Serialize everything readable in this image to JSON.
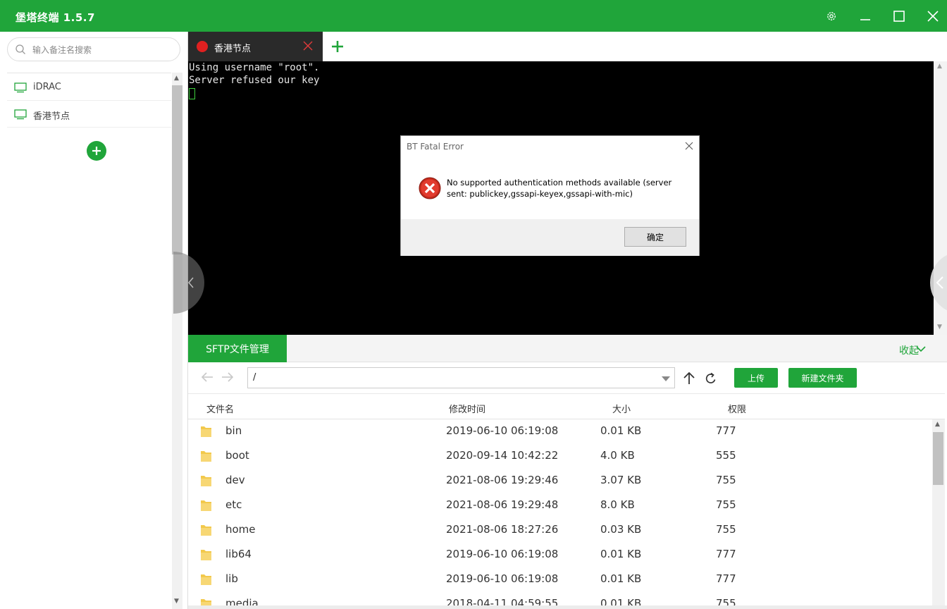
{
  "app": {
    "title": "堡塔终端 1.5.7"
  },
  "colors": {
    "brand": "#20a53a",
    "terminal_bg": "#000000",
    "tab_active_bg": "#2a2a2a",
    "status_dot": "#e02020"
  },
  "window_controls": [
    "gear-icon",
    "minimize-icon",
    "maximize-icon",
    "close-icon"
  ],
  "sidebar": {
    "search_placeholder": "输入备注名搜索",
    "servers": [
      {
        "label": "iDRAC",
        "icon": "monitor-icon"
      },
      {
        "label": "香港节点",
        "icon": "monitor-icon"
      }
    ]
  },
  "tabs": [
    {
      "label": "香港节点",
      "status": "disconnected"
    }
  ],
  "terminal": {
    "lines": [
      "Using username \"root\".",
      "Server refused our key"
    ]
  },
  "dialog": {
    "title": "BT Fatal Error",
    "message": "No supported authentication methods available (server sent: publickey,gssapi-keyex,gssapi-with-mic)",
    "ok_label": "确定",
    "icon": "error-icon"
  },
  "sftp": {
    "tab_label": "SFTP文件管理",
    "collapse_label": "收起",
    "path": "/",
    "upload_label": "上传",
    "new_folder_label": "新建文件夹",
    "columns": {
      "name": "文件名",
      "mtime": "修改时间",
      "size": "大小",
      "perm": "权限"
    },
    "files": [
      {
        "name": "bin",
        "mtime": "2019-06-10 06:19:08",
        "size": "0.01 KB",
        "perm": "777"
      },
      {
        "name": "boot",
        "mtime": "2020-09-14 10:42:22",
        "size": "4.0 KB",
        "perm": "555"
      },
      {
        "name": "dev",
        "mtime": "2021-08-06 19:29:46",
        "size": "3.07 KB",
        "perm": "755"
      },
      {
        "name": "etc",
        "mtime": "2021-08-06 19:29:48",
        "size": "8.0 KB",
        "perm": "755"
      },
      {
        "name": "home",
        "mtime": "2021-08-06 18:27:26",
        "size": "0.03 KB",
        "perm": "755"
      },
      {
        "name": "lib64",
        "mtime": "2019-06-10 06:19:08",
        "size": "0.01 KB",
        "perm": "777"
      },
      {
        "name": "lib",
        "mtime": "2019-06-10 06:19:08",
        "size": "0.01 KB",
        "perm": "777"
      },
      {
        "name": "media",
        "mtime": "2018-04-11 04:59:55",
        "size": "0.01 KB",
        "perm": "755"
      }
    ]
  }
}
